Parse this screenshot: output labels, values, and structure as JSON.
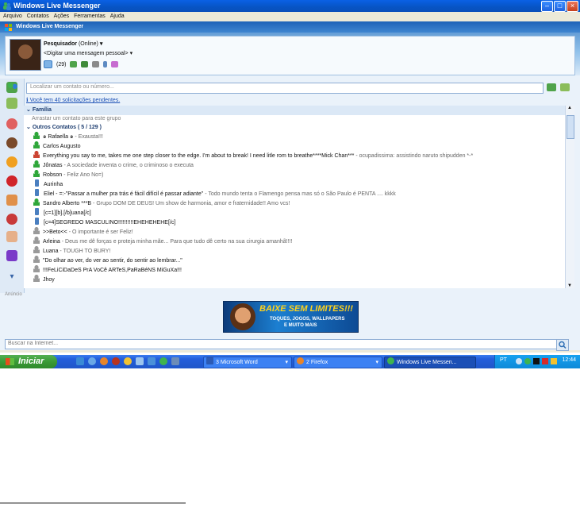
{
  "window": {
    "title": "Windows Live Messenger"
  },
  "menu": [
    "Arquivo",
    "Contatos",
    "Ações",
    "Ferramentas",
    "Ajuda"
  ],
  "header": {
    "brand": "Windows Live Messenger"
  },
  "profile": {
    "name": "Pesquisador",
    "status": "(Online)",
    "personal_message": "<Digitar uma mensagem pessoal>",
    "mail_count": "(29)"
  },
  "search": {
    "placeholder": "Localizar um contato ou número..."
  },
  "notice": "Você tem 40 solicitações pendentes.",
  "groups": {
    "familia": "Família",
    "familia_hint": "Arrastar um contato para este grupo",
    "outros": "Outros Contatos ( 5 / 129 )"
  },
  "contacts": [
    {
      "name": "๑ Rafaella ๑",
      "message": "Exausta!!!",
      "status": "online"
    },
    {
      "name": "Carlos Augusto",
      "message": "",
      "status": "online"
    },
    {
      "name": "Everything you say to me, takes me one step closer to the edge. I'm about to break! I need litle rom to breathe****Mick Chan***",
      "message": "ocupadissima: assistindo naruto shipudden *-*",
      "status": "busy"
    },
    {
      "name": "Jônatas",
      "message": "A sociedade inventa o crime, o criminoso o executa",
      "status": "online"
    },
    {
      "name": "Robson",
      "message": "Feliz Ano No=)",
      "status": "online"
    },
    {
      "name": "Aurinha",
      "message": "",
      "status": "mobile"
    },
    {
      "name": "Eliel - =:-\"Passar a mulher pra trás é fácil difícil é passar adiante\"",
      "message": "Todo mundo tenta o Flamengo pensa mas só o São Paulo é PENTA .... kkkk",
      "status": "mobile"
    },
    {
      "name": "Sandro Alberto ***B",
      "message": "Grupo DOM DE DEUS! Um show de harmonia, amor e fraternidade!! Amo vcs!",
      "status": "online"
    },
    {
      "name": "[c=1][b].[/b]uana[/c]",
      "message": "",
      "status": "mobile"
    },
    {
      "name": "[c=4]SEGREDO MASCULINO!!!!!!!!!!EHEHEHEHE[/c]",
      "message": "",
      "status": "mobile"
    },
    {
      "name": ">>Beto<<",
      "message": "O importante é ser Feliz!",
      "status": "offline"
    },
    {
      "name": "Arleina",
      "message": "Deus me dê forças e proteja minha mãe... Para que tudo dê certo na sua cirurgia amanhã!!!!",
      "status": "offline"
    },
    {
      "name": "Luana",
      "message": "TOUGH TO BURY!",
      "status": "offline"
    },
    {
      "name": "\"Do olhar ao ver, do ver ao sentir, do sentir ao lembrar...\"",
      "message": "",
      "status": "offline"
    },
    {
      "name": "!!!FeLiCiDaDeS PrA VoCê ARTeS,PaRaBéNS MiGuXa!!!",
      "message": "",
      "status": "offline"
    },
    {
      "name": "Jhoy",
      "message": "",
      "status": "offline"
    }
  ],
  "ad": {
    "label": "Anúncio",
    "line1": "BAIXE SEM LIMITES!!!",
    "line2": "TOQUES, JOGOS, WALLPAPERS",
    "line3": "E MUITO MAIS"
  },
  "internet_search": {
    "placeholder": "Buscar na Internet..."
  },
  "taskbar": {
    "start": "Iniciar",
    "buttons": [
      "3 Microsoft Word",
      "2 Firefox",
      "Windows Live Messen..."
    ],
    "lang": "PT",
    "clock": "12:44"
  },
  "colors": {
    "titlebar": "#0a61e6",
    "taskbar": "#245edb",
    "start": "#3a9a36"
  }
}
